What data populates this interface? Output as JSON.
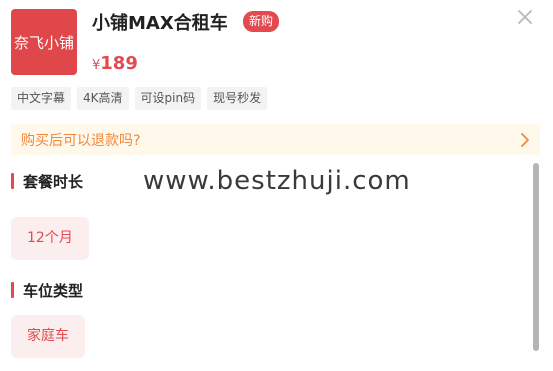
{
  "product": {
    "logo_text": "奈飞小铺",
    "title": "小铺MAX合租车",
    "badge": "新购",
    "currency_symbol": "¥",
    "price": "189"
  },
  "tags": [
    "中文字幕",
    "4K高清",
    "可设pin码",
    "现号秒发"
  ],
  "refund": {
    "label": "购买后可以退款吗?"
  },
  "sections": {
    "duration": {
      "title": "套餐时长",
      "option": "12个月"
    },
    "seat_type": {
      "title": "车位类型",
      "option": "家庭车"
    }
  },
  "watermark": "www.bestzhuji.com",
  "colors": {
    "accent": "#e24a4f",
    "refund_text": "#f2873d",
    "refund_bg": "#fff9ec"
  },
  "icons": {
    "close": "close-icon",
    "chevron": "chevron-right-icon"
  }
}
